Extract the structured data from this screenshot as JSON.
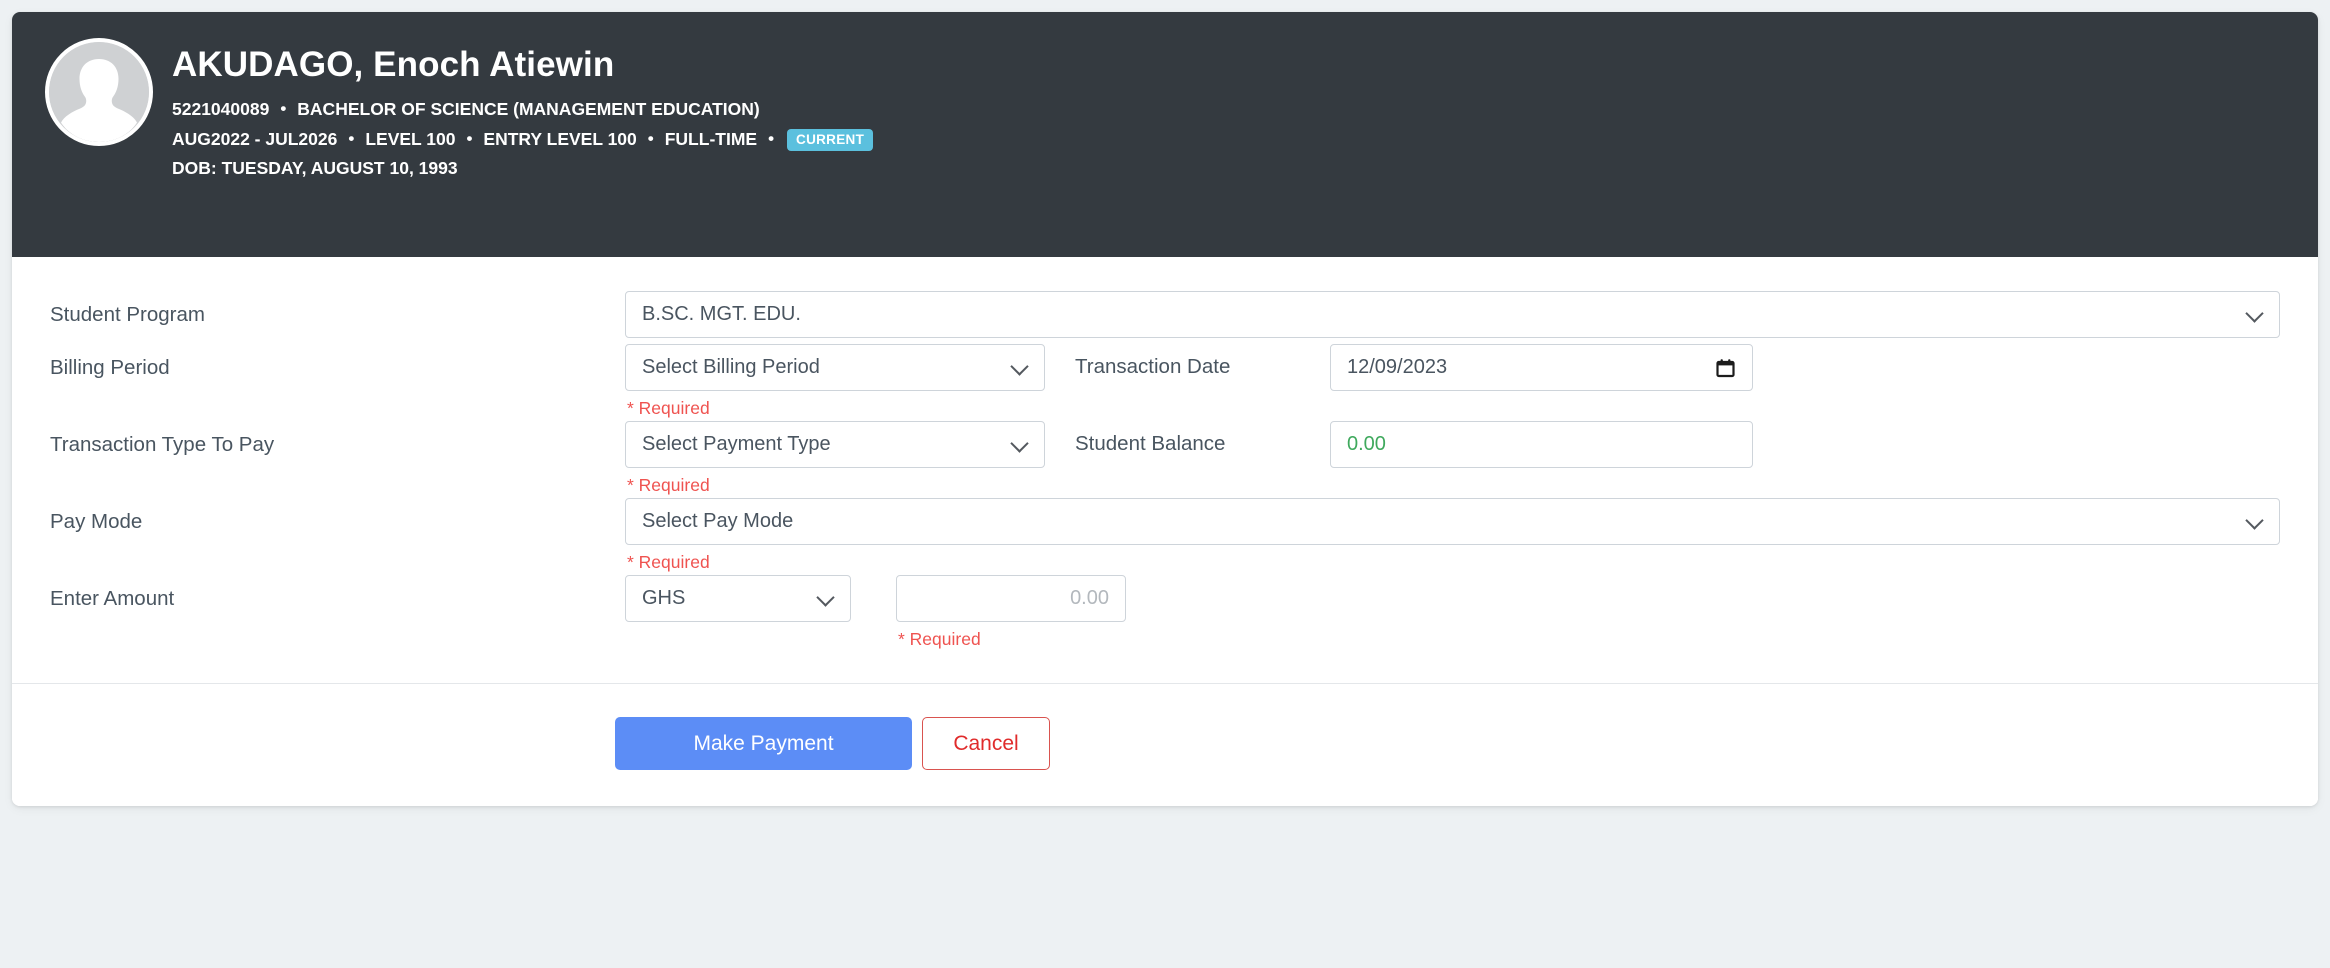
{
  "header": {
    "avatar_icon": "default-user-avatar-icon",
    "student_name": "AKUDAGO, Enoch Atiewin",
    "student_id": "5221040089",
    "program_full": "BACHELOR OF SCIENCE (MANAGEMENT EDUCATION)",
    "period": "AUG2022 - JUL2026",
    "level": "LEVEL 100",
    "entry_level": "ENTRY LEVEL 100",
    "study_mode": "FULL-TIME",
    "status_badge": "CURRENT",
    "dob": "DOB: TUESDAY, AUGUST 10, 1993",
    "separator": "•"
  },
  "form": {
    "student_program": {
      "label": "Student Program",
      "value": "B.SC. MGT. EDU."
    },
    "billing_period": {
      "label": "Billing Period",
      "value": "Select Billing Period",
      "error": "* Required"
    },
    "transaction_date": {
      "label": "Transaction Date",
      "value": "12/09/2023",
      "icon": "calendar-icon"
    },
    "transaction_type": {
      "label": "Transaction Type To Pay",
      "value": "Select Payment Type",
      "error": "* Required"
    },
    "student_balance": {
      "label": "Student Balance",
      "value": "0.00"
    },
    "pay_mode": {
      "label": "Pay Mode",
      "value": "Select Pay Mode",
      "error": "* Required"
    },
    "enter_amount": {
      "label": "Enter Amount",
      "currency": "GHS",
      "amount_placeholder": "0.00",
      "error": "* Required"
    }
  },
  "actions": {
    "submit_label": "Make Payment",
    "cancel_label": "Cancel"
  },
  "colors": {
    "header_bg": "#343a40",
    "page_bg": "#edf1f3",
    "badge": "#5bc0de",
    "primary_button": "#5c8df6",
    "cancel_border": "#d9534f",
    "error_text": "#ef5350",
    "balance_green": "#3fa95d"
  }
}
